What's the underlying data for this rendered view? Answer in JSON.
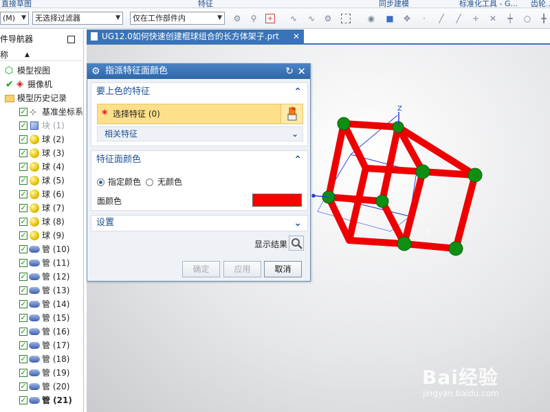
{
  "ribbon": {
    "item1": "直接草图",
    "item2": "特征",
    "item3": "同步建模",
    "item4": "标准化工具 - G...",
    "item5": "齿轮..."
  },
  "toolbar": {
    "menu_label": "(M)",
    "filter_combo": "无选择过滤器",
    "scope_combo": "仅在工作部件内"
  },
  "navigator": {
    "title": "部件导航器",
    "column_header": "名称",
    "items": [
      {
        "label": "模型视图"
      },
      {
        "label": "摄像机"
      },
      {
        "label": "模型历史记录"
      },
      {
        "label": "基准坐标系"
      },
      {
        "label": "块 (1)"
      },
      {
        "label": "球 (2)"
      },
      {
        "label": "球 (3)"
      },
      {
        "label": "球 (4)"
      },
      {
        "label": "球 (5)"
      },
      {
        "label": "球 (6)"
      },
      {
        "label": "球 (7)"
      },
      {
        "label": "球 (8)"
      },
      {
        "label": "球 (9)"
      },
      {
        "label": "管 (10)"
      },
      {
        "label": "管 (11)"
      },
      {
        "label": "管 (12)"
      },
      {
        "label": "管 (13)"
      },
      {
        "label": "管 (14)"
      },
      {
        "label": "管 (15)"
      },
      {
        "label": "管 (16)"
      },
      {
        "label": "管 (17)"
      },
      {
        "label": "管 (18)"
      },
      {
        "label": "管 (19)"
      },
      {
        "label": "管 (20)"
      },
      {
        "label": "管 (21)"
      }
    ]
  },
  "tab": {
    "title": "UG12.0如何快速创建棍球组合的长方体架子.prt"
  },
  "dialog": {
    "title": "指派特征面颜色",
    "section_features": "要上色的特征",
    "select_feature": "选择特征 (0)",
    "related_features": "相关特征",
    "section_color": "特征面颜色",
    "radio_specify": "指定颜色",
    "radio_none": "无颜色",
    "face_color_label": "面颜色",
    "face_color": "#ff0000",
    "section_settings": "设置",
    "show_result": "显示结果",
    "ok": "确定",
    "apply": "应用",
    "cancel": "取消"
  },
  "viewport": {
    "axis_z": "Z",
    "axis_y": "Y"
  },
  "watermark": {
    "brand": "Bai经验",
    "url": "jingyan.baidu.com"
  }
}
